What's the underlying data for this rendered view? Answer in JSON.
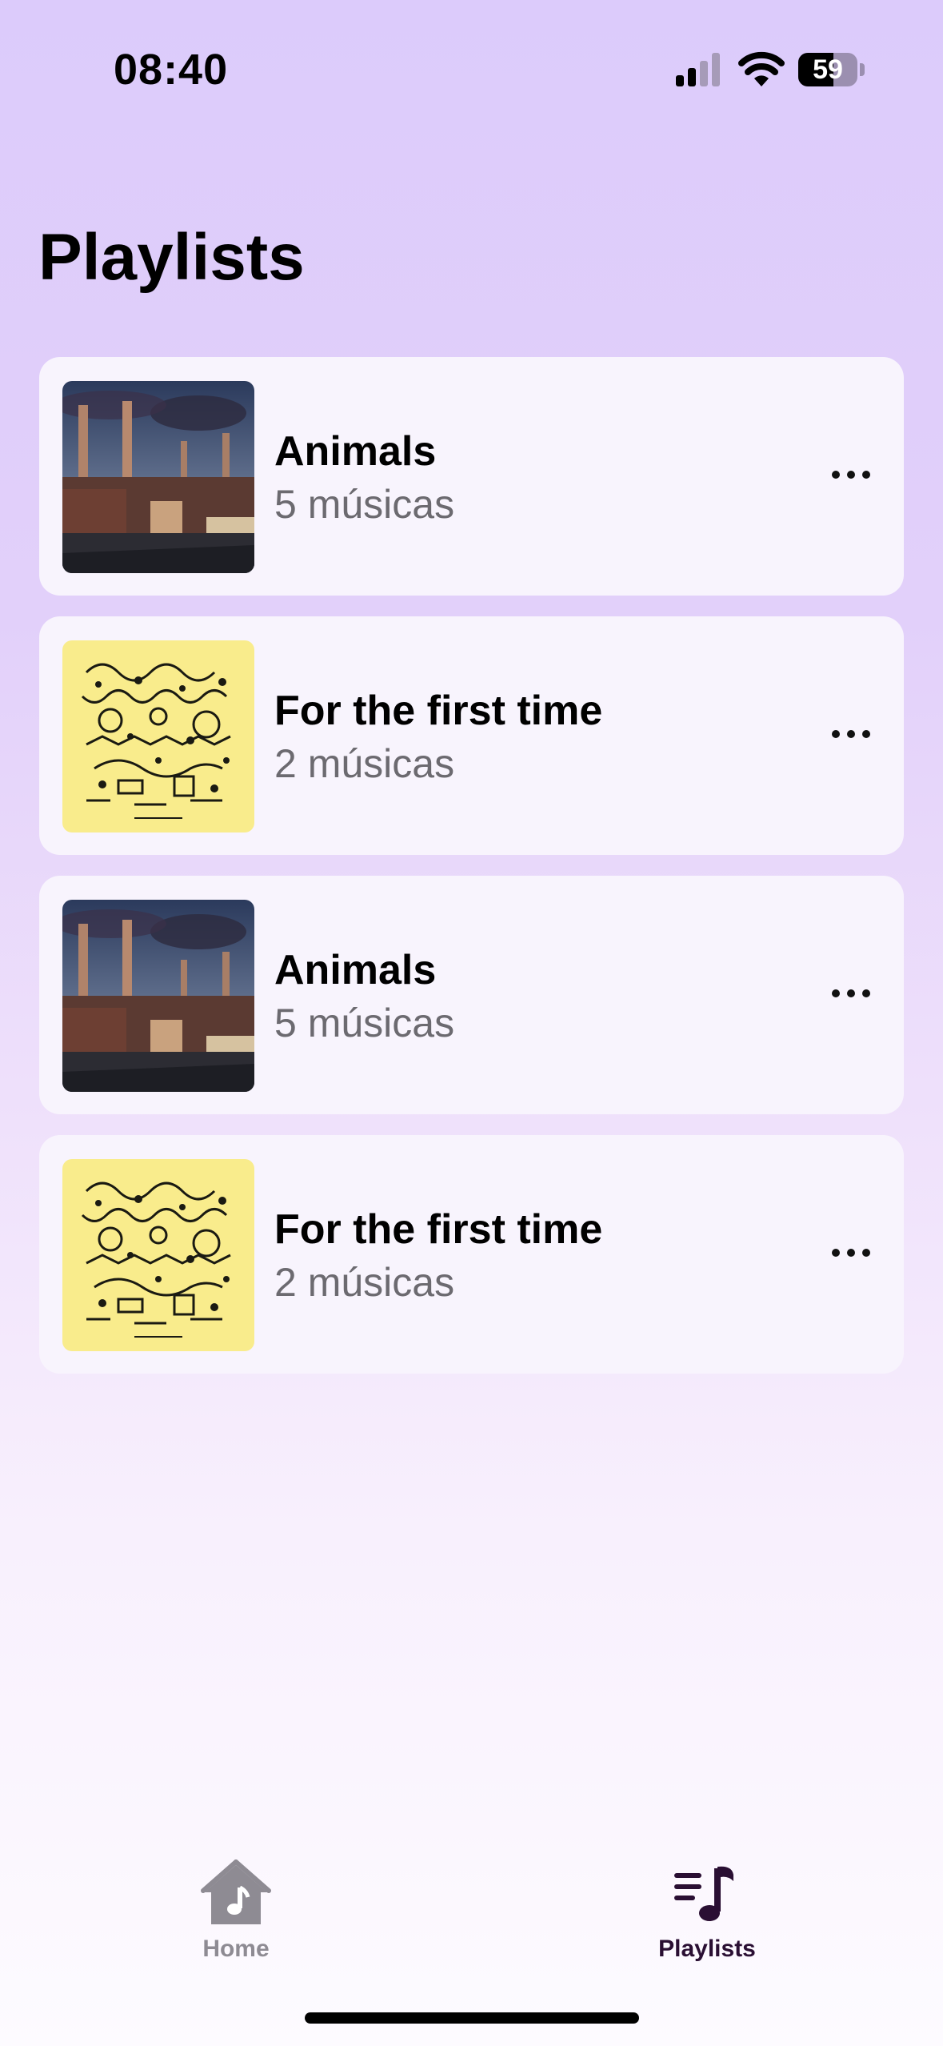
{
  "status_bar": {
    "time": "08:40",
    "battery_level": "59",
    "battery_fraction": 0.59,
    "signal_icon": "cellular-signal-icon",
    "wifi_icon": "wifi-icon"
  },
  "page": {
    "title": "Playlists"
  },
  "playlists": [
    {
      "title": "Animals",
      "subtitle": "5 músicas",
      "cover": "animals-cover",
      "more_icon": "ellipsis-icon"
    },
    {
      "title": "For the first time",
      "subtitle": "2 músicas",
      "cover": "for-the-first-time-cover",
      "more_icon": "ellipsis-icon"
    },
    {
      "title": "Animals",
      "subtitle": "5 músicas",
      "cover": "animals-cover",
      "more_icon": "ellipsis-icon"
    },
    {
      "title": "For the first time",
      "subtitle": "2 músicas",
      "cover": "for-the-first-time-cover",
      "more_icon": "ellipsis-icon"
    }
  ],
  "tab_bar": {
    "tabs": [
      {
        "label": "Home",
        "icon": "home-music-icon",
        "active": false
      },
      {
        "label": "Playlists",
        "icon": "playlist-music-icon",
        "active": true
      }
    ]
  },
  "colors": {
    "background_top": "#dccbfb",
    "background_bottom": "#fdfbff",
    "card": "#f8f4fd",
    "active_tab": "#2a0f33",
    "inactive_tab": "#8e8b93"
  }
}
